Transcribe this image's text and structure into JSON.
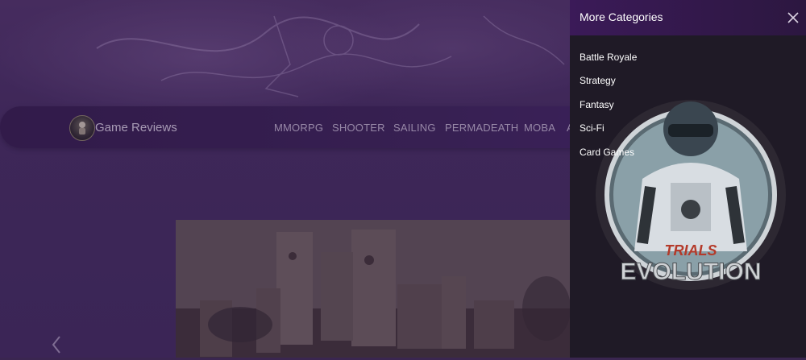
{
  "brand": {
    "name": "Game Reviews",
    "logo_caption": "EVOLUTION"
  },
  "nav": {
    "items": [
      "MMORPG",
      "SHOOTER",
      "SAILING",
      "PERMADEATH",
      "MOBA",
      "A"
    ]
  },
  "drawer": {
    "title": "More Categories",
    "categories": [
      "Battle Royale",
      "Strategy",
      "Fantasy",
      "Sci-Fi",
      "Card Games"
    ],
    "promo_title": "TRIALS",
    "promo_subtitle": "EVOLUTION"
  },
  "icons": {
    "close": "close-icon",
    "prev": "chevron-left-icon"
  },
  "colors": {
    "accent": "#3b1a58",
    "drawer_bg": "#1f1a26",
    "nav_bg": "#2e1a44"
  }
}
